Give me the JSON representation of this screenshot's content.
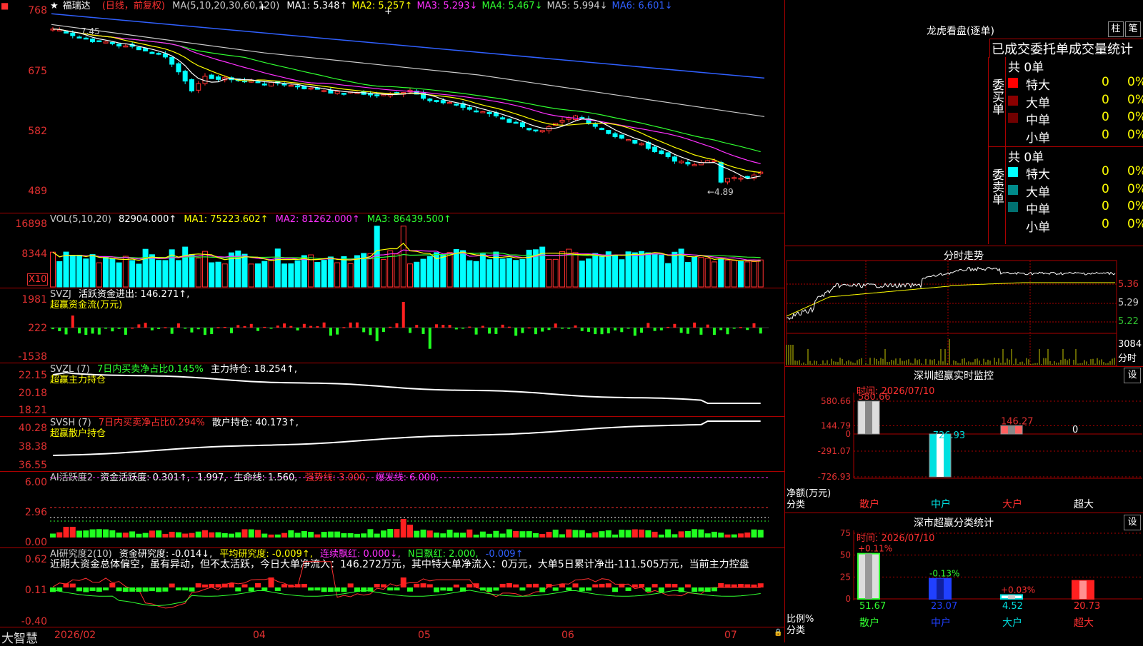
{
  "stock": {
    "name": "福瑞达",
    "mode": "(日线，前复权)",
    "star": "★"
  },
  "price_panel": {
    "yticks": [
      "768",
      "675",
      "582",
      "489"
    ],
    "ma_label": "MA(5,10,20,30,60,120)",
    "ma": [
      {
        "label": "MA1:",
        "value": "5.348↑",
        "color": "#ffffff"
      },
      {
        "label": "MA2:",
        "value": "5.257↑",
        "color": "#ffff00"
      },
      {
        "label": "MA3:",
        "value": "5.293↓",
        "color": "#ff30ff"
      },
      {
        "label": "MA4:",
        "value": "5.467↓",
        "color": "#30ff30"
      },
      {
        "label": "MA5:",
        "value": "5.994↓",
        "color": "#cccccc"
      },
      {
        "label": "MA6:",
        "value": "6.601↓",
        "color": "#3060ff"
      }
    ],
    "high_label": "7.45",
    "low_label": "←4.89"
  },
  "vol_panel": {
    "yticks": [
      "16898",
      "8344"
    ],
    "unit": "X10",
    "label": "VOL(5,10,20)",
    "value": "82904.000↑",
    "ma1": "MA1: 75223.602↑",
    "ma2": "MA2: 81262.000↑",
    "ma3": "MA3: 86439.500↑"
  },
  "svzj_panel": {
    "yticks": [
      "1981",
      "222",
      "-1538"
    ],
    "label": "SVZJ",
    "desc": "活跃资金进出: 146.271↑,",
    "sub": "超赢资金流(万元)"
  },
  "svzl_panel": {
    "yticks": [
      "22.15",
      "20.18",
      "18.21"
    ],
    "label": "SVZL (7)",
    "desc": "7日内买卖净占比0.145%",
    "desc2": "主力持仓: 18.254↑,",
    "sub": "超赢主力持仓"
  },
  "svsh_panel": {
    "yticks": [
      "40.28",
      "38.38",
      "36.55"
    ],
    "label": "SVSH (7)",
    "desc": "7日内买卖净占比0.294%",
    "desc2": "散户持仓: 40.173↑,",
    "sub": "超赢散户持仓"
  },
  "ai1_panel": {
    "yticks": [
      "6.00",
      "2.96",
      "0.00"
    ],
    "label": "AI活跃度2",
    "d1": "资金活跃度: 0.301↑,",
    "d2": "1.997,",
    "d3": "生命线: 1.560,",
    "d4": "强势线: 3.000,",
    "d5": "爆发线: 6.000,"
  },
  "ai2_panel": {
    "yticks": [
      "0.62",
      "0.11",
      "-0.40"
    ],
    "label": "AI研究度2(10)",
    "d1": "资金研究度: -0.014↓,",
    "d2": "平均研究度: -0.009↑,",
    "d3": "连续飘红: 0.000↓,",
    "d4": "N日飘红: 2.000,",
    "d5": "-0.009↑",
    "comment": "近期大资金总体偏空，虽有异动，但不太活跃，今日大单净流入：146.272万元，其中特大单净流入：0万元，大单5日累计净出-111.505万元，当前主力控盘"
  },
  "xaxis": [
    "2026/02",
    "04",
    "05",
    "06",
    "07"
  ],
  "brand": "大智慧",
  "right": {
    "title": "龙虎看盘(逐单)",
    "btn1": "柱",
    "btn2": "笔",
    "tabs": "已成交委托单成交量统计",
    "buy_title": "委买单",
    "sell_title": "委卖单",
    "buy_total": "共 0单",
    "sell_total": "共 0单",
    "buy_rows": [
      {
        "label": "特大",
        "v1": "0",
        "v2": "0%",
        "color": "#ff0000"
      },
      {
        "label": "大单",
        "v1": "0",
        "v2": "0%",
        "color": "#8b0000"
      },
      {
        "label": "中单",
        "v1": "0",
        "v2": "0%",
        "color": "#700000"
      },
      {
        "label": "小单",
        "v1": "0",
        "v2": "0%",
        "color": "#000000"
      }
    ],
    "sell_rows": [
      {
        "label": "特大",
        "v1": "0",
        "v2": "0%",
        "color": "#00ffff"
      },
      {
        "label": "大单",
        "v1": "0",
        "v2": "0%",
        "color": "#008b8b"
      },
      {
        "label": "中单",
        "v1": "0",
        "v2": "0%",
        "color": "#007070"
      },
      {
        "label": "小单",
        "v1": "0",
        "v2": "0%",
        "color": "#000000"
      }
    ],
    "intraday_title": "分时走势",
    "intraday_ticks": [
      "5.36",
      "5.29",
      "5.22"
    ],
    "intraday_vol": "3084",
    "intraday_vol_unit": "分时",
    "sz_title": "深圳超赢实时监控",
    "sz_btn": "设",
    "sz_time": "时间: 2026/07/10",
    "sz_yticks": [
      "580.66",
      "144.79",
      "0",
      "-291.07",
      "-726.93"
    ],
    "sz_ylabel1": "净额(万元)",
    "sz_ylabel2": "分类",
    "sz_cats": [
      "散户",
      "中户",
      "大户",
      "超大"
    ],
    "sz_values": [
      "580.66",
      "-726.93",
      "146.27",
      "0"
    ],
    "sc_title": "深市超赢分类统计",
    "sc_btn": "设",
    "sc_time": "时间: 2026/07/10",
    "sc_yticks": [
      "75",
      "50",
      "25",
      "0"
    ],
    "sc_ylabel1": "比例%",
    "sc_ylabel2": "分类",
    "sc_cats": [
      "散户",
      "中户",
      "大户",
      "超大"
    ],
    "sc_top": [
      "+0.11%",
      "-0.13%",
      "+0.03%"
    ],
    "sc_bottom": [
      "51.67",
      "23.07",
      "4.52",
      "20.73"
    ]
  },
  "chart_data": {
    "type": "bar",
    "title": "深圳超赢实时监控",
    "categories": [
      "散户",
      "中户",
      "大户",
      "超大"
    ],
    "values": [
      580.66,
      -726.93,
      146.27,
      0
    ],
    "ylabel": "净额(万元)",
    "ylim": [
      -726.93,
      580.66
    ],
    "proportion": {
      "categories": [
        "散户",
        "中户",
        "大户",
        "超大"
      ],
      "values": [
        51.67,
        23.07,
        4.52,
        20.73
      ],
      "ylim": [
        0,
        75
      ]
    }
  }
}
